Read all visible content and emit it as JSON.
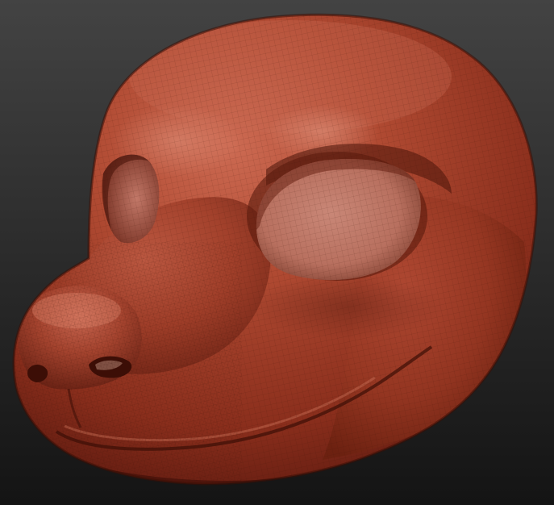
{
  "viewport": {
    "background_top": "#434343",
    "background_bottom": "#141414"
  },
  "model": {
    "name": "sculpted-animal-head",
    "material_base": "#a8402a",
    "material_highlight": "#d07058",
    "material_shadow": "#4a140c",
    "wireframe_visible": true
  }
}
